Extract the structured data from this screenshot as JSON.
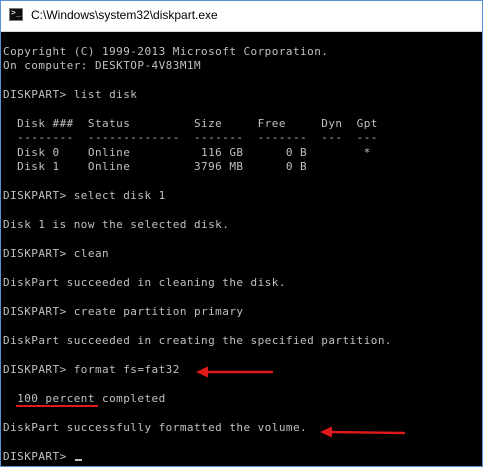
{
  "window": {
    "title": "C:\\Windows\\system32\\diskpart.exe"
  },
  "console": {
    "copyright": "Copyright (C) 1999-2013 Microsoft Corporation.",
    "computer": "On computer: DESKTOP-4V83M1M",
    "cmd_list_disk": "DISKPART> list disk",
    "disk_table": {
      "header": "  Disk ###  Status         Size     Free     Dyn  Gpt",
      "separator": "  --------  -------------  -------  -------  ---  ---",
      "rows": [
        "  Disk 0    Online          116 GB      0 B        *",
        "  Disk 1    Online         3796 MB      0 B"
      ]
    },
    "cmd_select": "DISKPART> select disk 1",
    "msg_select": "Disk 1 is now the selected disk.",
    "cmd_clean": "DISKPART> clean",
    "msg_clean": "DiskPart succeeded in cleaning the disk.",
    "cmd_create": "DISKPART> create partition primary",
    "msg_create": "DiskPart succeeded in creating the specified partition.",
    "cmd_format": "DISKPART> format fs=fat32",
    "progress": "  100 percent completed",
    "msg_format": "DiskPart successfully formatted the volume.",
    "prompt": "DISKPART> "
  },
  "colors": {
    "console_bg": "#000000",
    "console_text": "#c0c0c0",
    "annotation": "#e01a1a"
  }
}
